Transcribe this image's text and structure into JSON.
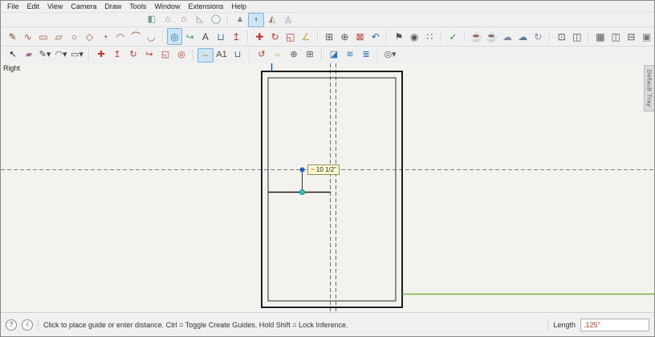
{
  "menu": {
    "items": [
      {
        "label": "File",
        "name": "menu-file"
      },
      {
        "label": "Edit",
        "name": "menu-edit"
      },
      {
        "label": "View",
        "name": "menu-view"
      },
      {
        "label": "Camera",
        "name": "menu-camera"
      },
      {
        "label": "Draw",
        "name": "menu-draw"
      },
      {
        "label": "Tools",
        "name": "menu-tools"
      },
      {
        "label": "Window",
        "name": "menu-window"
      },
      {
        "label": "Extensions",
        "name": "menu-extensions"
      },
      {
        "label": "Help",
        "name": "menu-help"
      }
    ]
  },
  "toolbars": {
    "row1": [
      {
        "name": "shape-box-icon",
        "glyph": "◧",
        "color": "#6f9e97"
      },
      {
        "name": "shape-house-icon",
        "glyph": "⌂",
        "color": "#8a7a6a"
      },
      {
        "name": "shape-gable-icon",
        "glyph": "⌂",
        "color": "#b0614a"
      },
      {
        "name": "shape-shed-icon",
        "glyph": "◺",
        "color": "#9a8a7a"
      },
      {
        "name": "shape-cylinder-icon",
        "glyph": "◯",
        "color": "#6f9e97"
      },
      {
        "sep": true
      },
      {
        "name": "shape-cone-icon",
        "glyph": "▲",
        "color": "#8a8a8a"
      },
      {
        "name": "shape-dome-icon",
        "glyph": "◖",
        "color": "#6f9e97",
        "pressed": true
      },
      {
        "name": "shape-pyramid-icon",
        "glyph": "◭",
        "color": "#9a8a7a"
      },
      {
        "name": "shape-prism-icon",
        "glyph": "◬",
        "color": "#8a8a8a"
      }
    ],
    "row2": [
      {
        "name": "pencil-tool-icon",
        "glyph": "✎",
        "color": "#7a4a2a"
      },
      {
        "name": "freehand-tool-icon",
        "glyph": "∿",
        "color": "#b5523c"
      },
      {
        "name": "rectangle-tool-icon",
        "glyph": "▭",
        "color": "#a05a3a"
      },
      {
        "name": "rotated-rectangle-tool-icon",
        "glyph": "▱",
        "color": "#a05a3a"
      },
      {
        "name": "circle-tool-icon",
        "glyph": "○",
        "color": "#b5523c"
      },
      {
        "name": "polygon-tool-icon",
        "glyph": "◇",
        "color": "#a05a3a"
      },
      {
        "name": "pie-tool-icon",
        "glyph": "◔",
        "color": "#b5523c"
      },
      {
        "name": "arc-tool-icon",
        "glyph": "◠",
        "color": "#a05a3a"
      },
      {
        "name": "two-point-arc-icon",
        "glyph": "⌒",
        "color": "#a05a3a"
      },
      {
        "name": "three-point-arc-icon",
        "glyph": "◡",
        "color": "#a05a3a"
      },
      {
        "sep": true
      },
      {
        "name": "offset-tool-icon",
        "glyph": "◎",
        "color": "#2f6fa5",
        "pressed": true
      },
      {
        "name": "follow-me-tool-icon",
        "glyph": "↪",
        "color": "#2f9f6f"
      },
      {
        "name": "text-a1-tool-icon",
        "glyph": "A",
        "color": "#444444"
      },
      {
        "name": "paint-bucket-tool-icon",
        "glyph": "⊔",
        "color": "#2f6fa5"
      },
      {
        "name": "push-pull-tool-icon",
        "glyph": "↥",
        "color": "#c0392b"
      },
      {
        "sep": true
      },
      {
        "name": "move-tool-icon",
        "glyph": "✚",
        "color": "#c0392b"
      },
      {
        "name": "rotate-tool-icon",
        "glyph": "↻",
        "color": "#c0392b"
      },
      {
        "name": "scale-tool-icon",
        "glyph": "◱",
        "color": "#c0392b"
      },
      {
        "name": "protractor-tool-icon",
        "glyph": "∠",
        "color": "#caa53a"
      },
      {
        "sep": true
      },
      {
        "name": "zoom-window-icon",
        "glyph": "⊞",
        "color": "#555555"
      },
      {
        "name": "zoom-tool-icon",
        "glyph": "⊕",
        "color": "#555555"
      },
      {
        "name": "zoom-extents-icon",
        "glyph": "⊠",
        "color": "#c0392b"
      },
      {
        "name": "previous-view-icon",
        "glyph": "↶",
        "color": "#2f6fa5"
      },
      {
        "sep": true
      },
      {
        "name": "position-camera-icon",
        "glyph": "⚑",
        "color": "#555555"
      },
      {
        "name": "look-around-icon",
        "glyph": "◉",
        "color": "#555555"
      },
      {
        "name": "walk-tool-icon",
        "glyph": "∷",
        "color": "#555555"
      },
      {
        "sep": true
      },
      {
        "name": "model-checkup-icon",
        "glyph": "✓",
        "color": "#2e8b2e"
      },
      {
        "sep": true
      },
      {
        "name": "render-teapot-icon",
        "glyph": "☕",
        "color": "#6a4a2a"
      },
      {
        "name": "render-settings-icon",
        "glyph": "☕",
        "color": "#8a6a4a"
      },
      {
        "name": "cloud-upload-icon",
        "glyph": "☁",
        "color": "#7a8aa0"
      },
      {
        "name": "cloud-render-icon",
        "glyph": "☁",
        "color": "#5a7a9a"
      },
      {
        "name": "cloud-sync-icon",
        "glyph": "↻",
        "color": "#7a8aa0"
      },
      {
        "sep": true
      },
      {
        "name": "export-doc-icon",
        "glyph": "⊡",
        "color": "#555555"
      },
      {
        "name": "send-to-layout-icon",
        "glyph": "◫",
        "color": "#555555"
      },
      {
        "sep": true
      },
      {
        "name": "grid-view-icon",
        "glyph": "▦",
        "color": "#555555"
      },
      {
        "name": "split-view-icon",
        "glyph": "◫",
        "color": "#555555"
      },
      {
        "name": "frame-view-icon",
        "glyph": "⊟",
        "color": "#555555"
      },
      {
        "name": "lock-icon",
        "glyph": "▣",
        "color": "#777777"
      }
    ],
    "row3": [
      {
        "name": "select-tool-icon",
        "glyph": "↖",
        "color": "#111111"
      },
      {
        "name": "eraser-tool-icon",
        "glyph": "▰",
        "color": "#b06a9a"
      },
      {
        "name": "line-tools-icon",
        "glyph": "✎▾",
        "color": "#444444"
      },
      {
        "name": "arc-tools-icon",
        "glyph": "◠▾",
        "color": "#444444"
      },
      {
        "name": "shape-tools-icon",
        "glyph": "▭▾",
        "color": "#444444"
      },
      {
        "sep": true
      },
      {
        "name": "move-icon",
        "glyph": "✚",
        "color": "#c0392b"
      },
      {
        "name": "push-pull-icon",
        "glyph": "↥",
        "color": "#c0392b"
      },
      {
        "name": "rotate-icon",
        "glyph": "↻",
        "color": "#c0392b"
      },
      {
        "name": "follow-me-icon",
        "glyph": "↪",
        "color": "#c0392b"
      },
      {
        "name": "scale-icon",
        "glyph": "◱",
        "color": "#c0392b"
      },
      {
        "name": "offset-icon",
        "glyph": "◎",
        "color": "#c0392b"
      },
      {
        "sep": true
      },
      {
        "name": "tape-measure-icon",
        "glyph": "↔",
        "color": "#b08a2a",
        "pressed": true
      },
      {
        "name": "dimension-icon",
        "glyph": "A1",
        "color": "#444444"
      },
      {
        "name": "paint-icon",
        "glyph": "⊔",
        "color": "#2f6fa5"
      },
      {
        "sep": true
      },
      {
        "name": "orbit-icon",
        "glyph": "↺",
        "color": "#c0392b"
      },
      {
        "name": "pan-icon",
        "glyph": "⇔",
        "color": "#caa53a"
      },
      {
        "name": "zoom-icon",
        "glyph": "⊕",
        "color": "#555555"
      },
      {
        "name": "zoom-extents-tool-icon",
        "glyph": "⊞",
        "color": "#555555"
      },
      {
        "sep": true
      },
      {
        "name": "section-plane-icon",
        "glyph": "◪",
        "color": "#2e75b6"
      },
      {
        "name": "section-fill-icon",
        "glyph": "≋",
        "color": "#2e75b6"
      },
      {
        "name": "section-display-icon",
        "glyph": "≣",
        "color": "#2e75b6"
      },
      {
        "sep": true
      },
      {
        "name": "styles-selector-icon",
        "glyph": "◎▾",
        "color": "#555555"
      }
    ]
  },
  "canvas": {
    "view_label": "Right",
    "measurement": "~ 10 1/2\"",
    "axis_green": "#79b23f",
    "axis_blue": "#2457c5",
    "endpoint_teal": "#2bc8b8"
  },
  "tray": {
    "label": "Default Tray"
  },
  "status_bar": {
    "help_glyph": "?",
    "info_glyph": "i",
    "message": "Click to place guide or enter distance. Ctrl = Toggle Create Guides. Hold Shift = Lock Inference.",
    "length_label": "Length",
    "length_value": ".125\""
  }
}
